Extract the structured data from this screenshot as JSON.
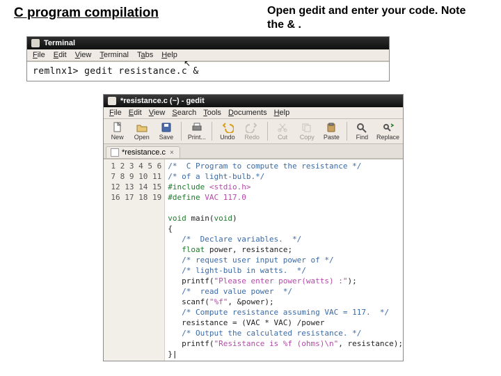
{
  "slide": {
    "title": "C program compilation",
    "note": "Open gedit and enter your code. Note the & ."
  },
  "terminal": {
    "title": "Terminal",
    "menu": {
      "file": "File",
      "edit": "Edit",
      "view": "View",
      "terminal": "Terminal",
      "tabs": "Tabs",
      "help": "Help"
    },
    "prompt": "remlnx1>",
    "command": "gedit  resistance.c    &"
  },
  "gedit": {
    "title": "*resistance.c (~) - gedit",
    "menu": {
      "file": "File",
      "edit": "Edit",
      "view": "View",
      "search": "Search",
      "tools": "Tools",
      "documents": "Documents",
      "help": "Help"
    },
    "toolbar": {
      "new": "New",
      "open": "Open",
      "save": "Save",
      "print": "Print...",
      "undo": "Undo",
      "redo": "Redo",
      "cut": "Cut",
      "copy": "Copy",
      "paste": "Paste",
      "find": "Find",
      "replace": "Replace"
    },
    "tab": {
      "label": "*resistance.c",
      "close": "×"
    },
    "code": {
      "l1": {
        "a": "/*  C Program to compute the resistance */"
      },
      "l2": {
        "a": "/* of a light-bulb.*/"
      },
      "l3": {
        "a": "#include ",
        "b": "<stdio.h>"
      },
      "l4": {
        "a": "#define ",
        "b": "VAC 117.0"
      },
      "l5": {
        "a": ""
      },
      "l6": {
        "a": "void",
        "b": " main(",
        "c": "void",
        "d": ")"
      },
      "l7": {
        "a": "{"
      },
      "l8": {
        "a": "   /*  Declare variables.  */"
      },
      "l9": {
        "a": "   ",
        "b": "float",
        "c": " power, resistance;"
      },
      "l10": {
        "a": "   /* request user input power of */"
      },
      "l11": {
        "a": "   /* light-bulb in watts.  */"
      },
      "l12": {
        "a": "   printf(",
        "b": "\"Please enter power(watts) :\"",
        "c": ");"
      },
      "l13": {
        "a": "   /*  read value power  */"
      },
      "l14": {
        "a": "   scanf(",
        "b": "\"%f\"",
        "c": ", &power);"
      },
      "l15": {
        "a": "   /* Compute resistance assuming VAC = 117.  */"
      },
      "l16": {
        "a": "   resistance = (VAC * VAC) /power"
      },
      "l17": {
        "a": "   /* Output the calculated resistance. */"
      },
      "l18": {
        "a": "   printf(",
        "b": "\"Resistance is %f (ohms)\\n\"",
        "c": ", resistance);"
      },
      "l19": {
        "a": "}"
      }
    },
    "line_count": 19
  }
}
